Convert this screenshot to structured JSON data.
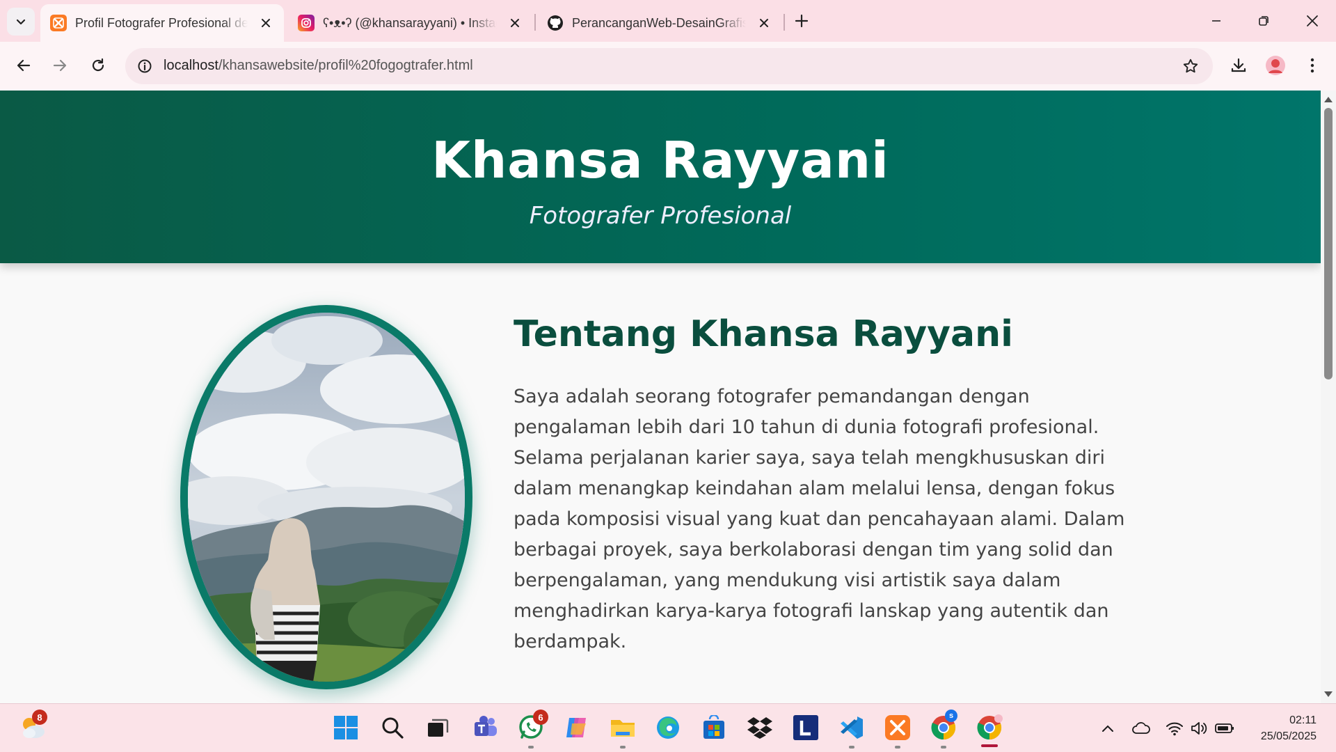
{
  "browser": {
    "tabs": [
      {
        "title": "Profil Fotografer Profesional dengan",
        "active": true,
        "favicon": "xampp-icon"
      },
      {
        "title": "ʕ•ᴥ•ʔ (@khansarayyani) • Instagram",
        "active": false,
        "favicon": "instagram-icon"
      },
      {
        "title": "PerancanganWeb-DesainGrafis",
        "active": false,
        "favicon": "github-icon"
      }
    ],
    "url_host": "localhost",
    "url_path": "/khansawebsite/profil%20fogogtrafer.html"
  },
  "page": {
    "hero": {
      "name": "Khansa Rayyani",
      "role": "Fotografer Profesional"
    },
    "about": {
      "title": "Tentang Khansa Rayyani",
      "text": "Saya adalah seorang fotografer pemandangan dengan pengalaman lebih dari 10 tahun di dunia fotografi profesional. Selama perjalanan karier saya, saya telah mengkhususkan diri dalam menangkap keindahan alam melalui lensa, dengan fokus pada komposisi visual yang kuat dan pencahayaan alami. Dalam berbagai proyek, saya berkolaborasi dengan tim yang solid dan berpengalaman, yang mendukung visi artistik saya dalam menghadirkan karya-karya fotografi lanskap yang autentik dan berdampak."
    },
    "colors": {
      "hero_start": "#0a5a45",
      "hero_end": "#00756a",
      "accent": "#0a7a68",
      "title": "#0a4e3e"
    }
  },
  "taskbar": {
    "weather_badge": "8",
    "whatsapp_badge": "6",
    "chrome_profile_badge": "s",
    "time": "02:11",
    "date": "25/05/2025"
  }
}
